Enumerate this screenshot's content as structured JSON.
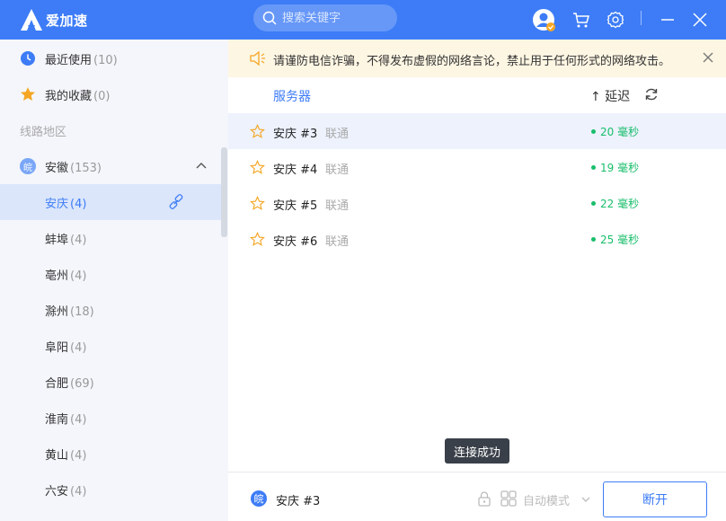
{
  "app": {
    "name": "爱加速"
  },
  "search": {
    "placeholder": "搜索关键字"
  },
  "sidebar": {
    "recent": {
      "label": "最近使用",
      "count": "(10)"
    },
    "favorites": {
      "label": "我的收藏",
      "count": "(0)"
    },
    "section_label": "线路地区",
    "province": {
      "badge": "皖",
      "label": "安徽",
      "count": "(153)"
    },
    "cities": [
      {
        "label": "安庆",
        "count": "(4)"
      },
      {
        "label": "蚌埠",
        "count": "(4)"
      },
      {
        "label": "亳州",
        "count": "(4)"
      },
      {
        "label": "滁州",
        "count": "(18)"
      },
      {
        "label": "阜阳",
        "count": "(4)"
      },
      {
        "label": "合肥",
        "count": "(69)"
      },
      {
        "label": "淮南",
        "count": "(4)"
      },
      {
        "label": "黄山",
        "count": "(4)"
      },
      {
        "label": "六安",
        "count": "(4)"
      }
    ]
  },
  "notice": {
    "text": "请谨防电信诈骗，不得发布虚假的网络言论，禁止用于任何形式的网络攻击。"
  },
  "list_header": {
    "server": "服务器",
    "latency": "↑ 延迟"
  },
  "servers": [
    {
      "name": "安庆 #3",
      "isp": "联通",
      "ping": "20 毫秒"
    },
    {
      "name": "安庆 #4",
      "isp": "联通",
      "ping": "19 毫秒"
    },
    {
      "name": "安庆 #5",
      "isp": "联通",
      "ping": "22 毫秒"
    },
    {
      "name": "安庆 #6",
      "isp": "联通",
      "ping": "25 毫秒"
    }
  ],
  "toast": "连接成功",
  "bottom": {
    "badge": "皖",
    "current": "安庆 #3",
    "mode": "自动模式",
    "disconnect": "断开"
  },
  "colors": {
    "primary": "#3d7cf6",
    "ping": "#19be6b",
    "notice_bg": "#fdf6e3",
    "star": "#f5a623"
  }
}
